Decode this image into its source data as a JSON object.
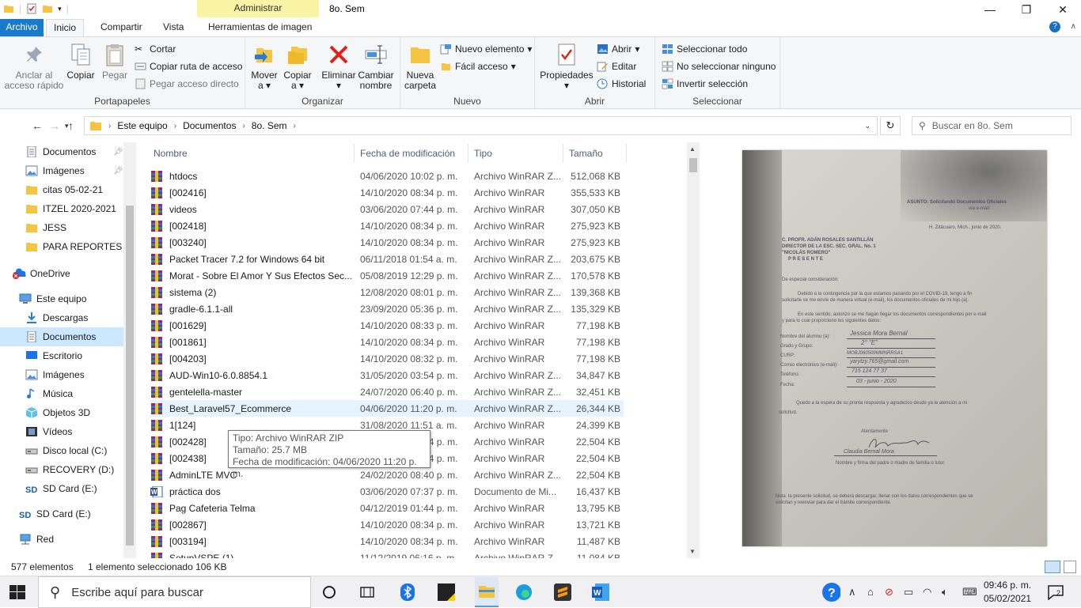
{
  "window": {
    "admin_tab": "Administrar",
    "title": "8o. Sem"
  },
  "tabs": [
    "Archivo",
    "Inicio",
    "Compartir",
    "Vista",
    "Herramientas de imagen"
  ],
  "ribbon": {
    "portapapeles": {
      "label": "Portapapeles",
      "anclar": "Anclar al acceso rápido",
      "copiar": "Copiar",
      "pegar": "Pegar",
      "cortar": "Cortar",
      "copiar_ruta": "Copiar ruta de acceso",
      "pegar_acceso": "Pegar acceso directo"
    },
    "organizar": {
      "label": "Organizar",
      "mover": "Mover a",
      "copiar": "Copiar a",
      "eliminar": "Eliminar",
      "cambiar": "Cambiar nombre"
    },
    "nuevo": {
      "label": "Nuevo",
      "carpeta": "Nueva carpeta",
      "elemento": "Nuevo elemento",
      "facil": "Fácil acceso"
    },
    "abrir": {
      "label": "Abrir",
      "propiedades": "Propiedades",
      "abrir": "Abrir",
      "editar": "Editar",
      "historial": "Historial"
    },
    "seleccionar": {
      "label": "Seleccionar",
      "todo": "Seleccionar todo",
      "ninguno": "No seleccionar ninguno",
      "invertir": "Invertir selección"
    }
  },
  "address": {
    "crumbs": [
      "Este equipo",
      "Documentos",
      "8o. Sem"
    ],
    "search_placeholder": "Buscar en 8o. Sem"
  },
  "nav": [
    {
      "label": "Documentos",
      "icon": "documents-icon",
      "pinned": true
    },
    {
      "label": "Imágenes",
      "icon": "pictures-icon",
      "pinned": true
    },
    {
      "label": "citas 05-02-21",
      "icon": "folder-icon"
    },
    {
      "label": "ITZEL 2020-2021",
      "icon": "folder-icon"
    },
    {
      "label": "JESS",
      "icon": "folder-icon"
    },
    {
      "label": "PARA REPORTES EVA",
      "icon": "folder-icon"
    },
    {
      "label": "OneDrive",
      "icon": "onedrive-icon"
    },
    {
      "label": "Este equipo",
      "icon": "computer-icon"
    },
    {
      "label": "Descargas",
      "icon": "downloads-icon"
    },
    {
      "label": "Documentos",
      "icon": "documents-icon",
      "selected": true
    },
    {
      "label": "Escritorio",
      "icon": "desktop-icon"
    },
    {
      "label": "Imágenes",
      "icon": "pictures-icon"
    },
    {
      "label": "Música",
      "icon": "music-icon"
    },
    {
      "label": "Objetos 3D",
      "icon": "3d-objects-icon"
    },
    {
      "label": "Vídeos",
      "icon": "videos-icon"
    },
    {
      "label": "Disco local (C:)",
      "icon": "drive-icon"
    },
    {
      "label": "RECOVERY (D:)",
      "icon": "drive-icon"
    },
    {
      "label": "SD Card (E:)",
      "icon": "sdcard-icon"
    },
    {
      "label": "SD Card (E:)",
      "icon": "sdcard-icon"
    },
    {
      "label": "Red",
      "icon": "network-icon"
    }
  ],
  "columns": [
    "Nombre",
    "Fecha de modificación",
    "Tipo",
    "Tamaño"
  ],
  "files": [
    {
      "name": "htdocs",
      "date": "04/06/2020 10:02 p. m.",
      "type": "Archivo WinRAR Z...",
      "size": "512,068 KB"
    },
    {
      "name": "[002416]",
      "date": "14/10/2020 08:34 p. m.",
      "type": "Archivo WinRAR",
      "size": "355,533 KB"
    },
    {
      "name": "videos",
      "date": "03/06/2020 07:44 p. m.",
      "type": "Archivo WinRAR",
      "size": "307,050 KB"
    },
    {
      "name": "[002418]",
      "date": "14/10/2020 08:34 p. m.",
      "type": "Archivo WinRAR",
      "size": "275,923 KB"
    },
    {
      "name": "[003240]",
      "date": "14/10/2020 08:34 p. m.",
      "type": "Archivo WinRAR",
      "size": "275,923 KB"
    },
    {
      "name": "Packet Tracer 7.2 for Windows 64 bit",
      "date": "06/11/2018 01:54 a. m.",
      "type": "Archivo WinRAR Z...",
      "size": "203,675 KB"
    },
    {
      "name": "Morat - Sobre El Amor Y Sus Efectos Sec...",
      "date": "05/08/2019 12:29 p. m.",
      "type": "Archivo WinRAR Z...",
      "size": "170,578 KB"
    },
    {
      "name": "sistema (2)",
      "date": "12/08/2020 08:01 p. m.",
      "type": "Archivo WinRAR Z...",
      "size": "139,368 KB"
    },
    {
      "name": "gradle-6.1.1-all",
      "date": "23/09/2020 05:36 p. m.",
      "type": "Archivo WinRAR Z...",
      "size": "135,329 KB"
    },
    {
      "name": "[001629]",
      "date": "14/10/2020 08:33 p. m.",
      "type": "Archivo WinRAR",
      "size": "77,198 KB"
    },
    {
      "name": "[001861]",
      "date": "14/10/2020 08:34 p. m.",
      "type": "Archivo WinRAR",
      "size": "77,198 KB"
    },
    {
      "name": "[004203]",
      "date": "14/10/2020 08:32 p. m.",
      "type": "Archivo WinRAR",
      "size": "77,198 KB"
    },
    {
      "name": "AUD-Win10-6.0.8854.1",
      "date": "31/05/2020 03:54 p. m.",
      "type": "Archivo WinRAR Z...",
      "size": "34,847 KB"
    },
    {
      "name": "gentelella-master",
      "date": "24/07/2020 06:40 p. m.",
      "type": "Archivo WinRAR Z...",
      "size": "32,451 KB"
    },
    {
      "name": "Best_Laravel57_Ecommerce",
      "date": "04/06/2020 11:20 p. m.",
      "type": "Archivo WinRAR Z...",
      "size": "26,344 KB",
      "selected": true
    },
    {
      "name": "1[124]",
      "date": "31/08/2020 11:51 a. m.",
      "type": "Archivo WinRAR",
      "size": "24,399 KB"
    },
    {
      "name": "[002428]",
      "date": "14/10/2020 08:34 p. m.",
      "type": "Archivo WinRAR",
      "size": "22,504 KB"
    },
    {
      "name": "[002438]",
      "date": "14/10/2020 08:34 p. m.",
      "type": "Archivo WinRAR",
      "size": "22,504 KB"
    },
    {
      "name": "AdminLTE MVC",
      "date": "24/02/2020 08:40 p. m.",
      "type": "Archivo WinRAR Z...",
      "size": "22,504 KB"
    },
    {
      "name": "práctica dos",
      "date": "03/06/2020 07:37 p. m.",
      "type": "Documento de Mi...",
      "size": "16,437 KB",
      "word": true
    },
    {
      "name": "Pag Cafeteria Telma",
      "date": "04/12/2019 01:44 p. m.",
      "type": "Archivo WinRAR",
      "size": "13,795 KB"
    },
    {
      "name": "[002867]",
      "date": "14/10/2020 08:34 p. m.",
      "type": "Archivo WinRAR",
      "size": "13,721 KB"
    },
    {
      "name": "[003194]",
      "date": "14/10/2020 08:34 p. m.",
      "type": "Archivo WinRAR",
      "size": "11,487 KB"
    },
    {
      "name": "SetupVSPE (1)",
      "date": "11/12/2019 06:16 p. m.",
      "type": "Archivo WinRAR Z...",
      "size": "11,084 KB"
    }
  ],
  "tooltip": {
    "line1": "Tipo: Archivo WinRAR ZIP",
    "line2": "Tamaño: 25.7 MB",
    "line3": "Fecha de modificación: 04/06/2020 11:20 p. m."
  },
  "preview": {
    "asunto": "ASUNTO: Solicitando Documentos Oficiales",
    "via": "vía e-mail",
    "place_date": "H. Zitácuaro, Mich., junio de 2020.",
    "to1": "C. PROFR. ADÁN ROSALES SANTILLÁN",
    "to2": "DIRECTOR DE LA ESC. SEC. GRAL. No. 1",
    "to3": "\"NICOLÁS ROMERO\"",
    "to4": "P R E S E N T E",
    "greet": "De especial consideración:",
    "p1": "Debido a la contingencia por la que estamos pasando por el COVID-19, tengo a fin",
    "p1b": "solicitarle se me envíe de manera virtual (e-mail), los documentos oficiales de mi hijo (a).",
    "p2": "En este sentido, autorizo se me hagan llegar los documentos correspondientes por e-mail",
    "p2b": "y para lo cual proporciono los siguientes datos:",
    "f1": "Nombre del alumno (a):",
    "v1": "Jessica Mora Bernal",
    "f2": "Grado y Grupo:",
    "v2": "2° \"E\"",
    "f3": "CURP:",
    "v3": "MOBJ060509MMNRRSA1",
    "f4": "Correo electrónico (e-mail):",
    "v4": "yarytzy.765@gmail.com",
    "f5": "Teléfono:",
    "v5": "715 124 77 37",
    "f6": "Fecha:",
    "v6": "03 - junio - 2020",
    "p3": "Quedo a la espera de su pronta respuesta y agradezco desde ya la atención a mi",
    "p3b": "solicitud.",
    "atent": "Atentamente",
    "signer": "Claudia Bernal Mora",
    "sign_caption": "Nombre y firma del padre o madre de familia o tutor",
    "nota": "Nota: la presente solicitud, se deberá descargar, llenar con los datos correspondientes que se",
    "nota2": "solicitan y reenviar para dar el trámite correspondiente."
  },
  "status": {
    "count": "577 elementos",
    "selection": "1 elemento seleccionado  106 KB"
  },
  "taskbar": {
    "search_placeholder": "Escribe aquí para buscar",
    "time": "09:46 p. m.",
    "date": "05/02/2021",
    "notifications": "2"
  }
}
